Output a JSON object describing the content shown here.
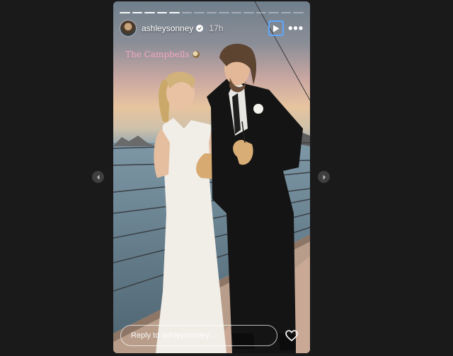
{
  "story": {
    "username": "ashleysonney",
    "timestamp": "17h",
    "caption": "The Campbells",
    "caption_icon": "coconut-icon",
    "progress_total": 15,
    "progress_done": 5,
    "reply_placeholder": "Reply to ashleysonney..."
  },
  "controls": {
    "play_icon": "play-icon",
    "more_icon": "more-options-icon",
    "like_icon": "heart-icon",
    "prev_icon": "chevron-left-icon",
    "next_icon": "chevron-right-icon"
  },
  "colors": {
    "background": "#1a1a1a",
    "play_focus": "#5fa8ff",
    "caption": "#f2a6c3"
  }
}
